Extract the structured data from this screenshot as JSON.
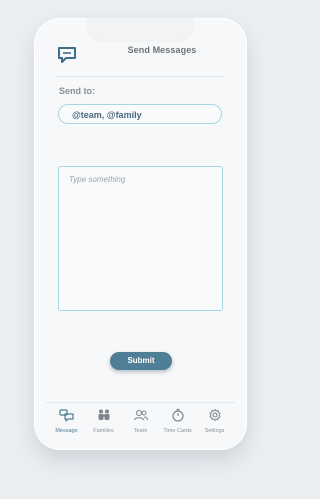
{
  "header": {
    "title": "Send Messages",
    "logo_icon": "chat-bubble-icon"
  },
  "send_to": {
    "label": "Send to:",
    "value": "@team, @family"
  },
  "message": {
    "placeholder": "Type something",
    "value": ""
  },
  "submit": {
    "label": "Submit"
  },
  "tabs": [
    {
      "label": "Message",
      "icon": "messages-icon",
      "active": true
    },
    {
      "label": "Families",
      "icon": "families-icon",
      "active": false
    },
    {
      "label": "Team",
      "icon": "team-icon",
      "active": false
    },
    {
      "label": "Time Cards",
      "icon": "stopwatch-icon",
      "active": false
    },
    {
      "label": "Settings",
      "icon": "gear-icon",
      "active": false
    }
  ],
  "colors": {
    "accent": "#4f7f97",
    "field_border": "#a8d6e6",
    "background": "#eceff2"
  }
}
